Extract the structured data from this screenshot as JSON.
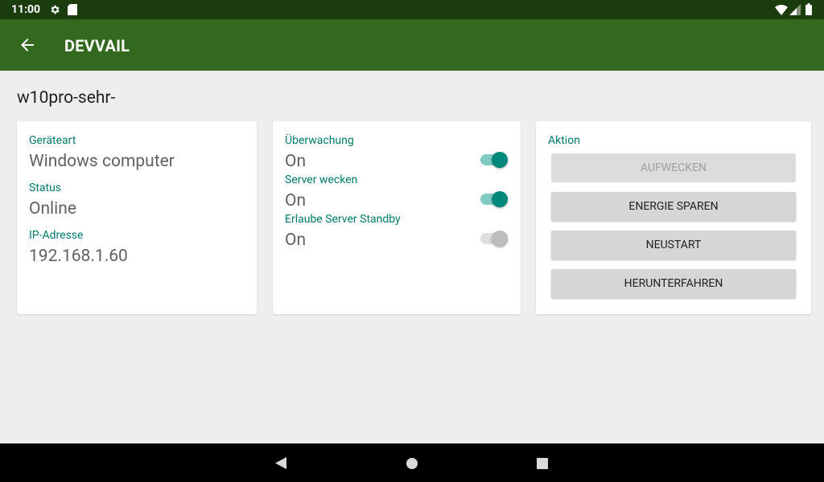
{
  "status_bar": {
    "time": "11:00"
  },
  "app_bar": {
    "title": "DEVVAIL"
  },
  "device_name": "w10pro-sehr-",
  "info_card": {
    "device_type_label": "Geräteart",
    "device_type_value": "Windows computer",
    "status_label": "Status",
    "status_value": "Online",
    "ip_label": "IP-Adresse",
    "ip_value": "192.168.1.60"
  },
  "settings_card": {
    "monitoring_label": "Überwachung",
    "monitoring_value": "On",
    "wake_label": "Server wecken",
    "wake_value": "On",
    "standby_label": "Erlaube Server Standby",
    "standby_value": "On"
  },
  "actions_card": {
    "title": "Aktion",
    "wake_button": "AUFWECKEN",
    "sleep_button": "ENERGIE SPAREN",
    "restart_button": "NEUSTART",
    "shutdown_button": "HERUNTERFAHREN"
  },
  "colors": {
    "status_bar": "#1b3d0e",
    "app_bar": "#33691e",
    "accent": "#00796b",
    "switch_on": "#00897b"
  }
}
